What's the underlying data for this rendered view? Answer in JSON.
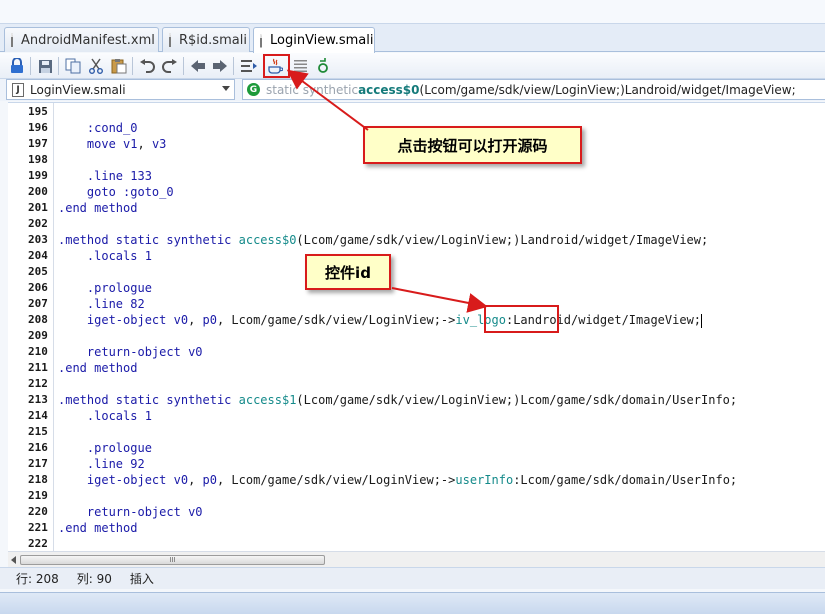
{
  "tabs": [
    {
      "label": "AndroidManifest.xml",
      "active": false
    },
    {
      "label": "R$id.smali",
      "active": false
    },
    {
      "label": "LoginView.smali",
      "active": true
    }
  ],
  "toolbar": {
    "icons": [
      "lock-icon",
      "save-icon",
      "copy-icon",
      "cut-icon",
      "paste-icon",
      "undo-icon",
      "redo-icon",
      "back-icon",
      "forward-icon",
      "outline-icon",
      "java-source-icon",
      "list-icon",
      "refresh-icon"
    ]
  },
  "file_select": {
    "value": "LoginView.smali"
  },
  "method_select": {
    "prefix": "static synthetic ",
    "name": "access$0",
    "signature": "(Lcom/game/sdk/view/LoginView;)Landroid/widget/ImageView;"
  },
  "code": [
    {
      "n": "195",
      "segs": []
    },
    {
      "n": "196",
      "segs": [
        {
          "t": "    ",
          "c": "txt"
        },
        {
          "t": ":cond_0",
          "c": "lbl"
        }
      ]
    },
    {
      "n": "197",
      "segs": [
        {
          "t": "    ",
          "c": "txt"
        },
        {
          "t": "move ",
          "c": "kw"
        },
        {
          "t": "v1",
          "c": "reg"
        },
        {
          "t": ", ",
          "c": "txt"
        },
        {
          "t": "v3",
          "c": "reg"
        }
      ]
    },
    {
      "n": "198",
      "segs": []
    },
    {
      "n": "199",
      "segs": [
        {
          "t": "    ",
          "c": "txt"
        },
        {
          "t": ".line ",
          "c": "kw"
        },
        {
          "t": "133",
          "c": "num"
        }
      ]
    },
    {
      "n": "200",
      "segs": [
        {
          "t": "    ",
          "c": "txt"
        },
        {
          "t": "goto ",
          "c": "kw"
        },
        {
          "t": ":goto_0",
          "c": "lbl"
        }
      ]
    },
    {
      "n": "201",
      "segs": [
        {
          "t": ".end method",
          "c": "kw"
        }
      ]
    },
    {
      "n": "202",
      "segs": []
    },
    {
      "n": "203",
      "segs": [
        {
          "t": ".method static synthetic ",
          "c": "kw"
        },
        {
          "t": "access$0",
          "c": "name"
        },
        {
          "t": "(Lcom/game/sdk/view/LoginView;)Landroid/widget/ImageView;",
          "c": "txt"
        }
      ]
    },
    {
      "n": "204",
      "segs": [
        {
          "t": "    ",
          "c": "txt"
        },
        {
          "t": ".locals ",
          "c": "kw"
        },
        {
          "t": "1",
          "c": "num"
        }
      ]
    },
    {
      "n": "205",
      "segs": []
    },
    {
      "n": "206",
      "segs": [
        {
          "t": "    ",
          "c": "txt"
        },
        {
          "t": ".prologue",
          "c": "kw"
        }
      ]
    },
    {
      "n": "207",
      "segs": [
        {
          "t": "    ",
          "c": "txt"
        },
        {
          "t": ".line ",
          "c": "kw"
        },
        {
          "t": "82",
          "c": "num"
        }
      ]
    },
    {
      "n": "208",
      "segs": [
        {
          "t": "    ",
          "c": "txt"
        },
        {
          "t": "iget-object ",
          "c": "kw"
        },
        {
          "t": "v0",
          "c": "reg"
        },
        {
          "t": ", ",
          "c": "txt"
        },
        {
          "t": "p0",
          "c": "reg"
        },
        {
          "t": ", Lcom/game/sdk/view/LoginView;->",
          "c": "txt"
        },
        {
          "t": "iv_logo",
          "c": "name"
        },
        {
          "t": ":Landroid/widget/ImageView;",
          "c": "txt"
        }
      ]
    },
    {
      "n": "209",
      "segs": []
    },
    {
      "n": "210",
      "segs": [
        {
          "t": "    ",
          "c": "txt"
        },
        {
          "t": "return-object ",
          "c": "kw"
        },
        {
          "t": "v0",
          "c": "reg"
        }
      ]
    },
    {
      "n": "211",
      "segs": [
        {
          "t": ".end method",
          "c": "kw"
        }
      ]
    },
    {
      "n": "212",
      "segs": []
    },
    {
      "n": "213",
      "segs": [
        {
          "t": ".method static synthetic ",
          "c": "kw"
        },
        {
          "t": "access$1",
          "c": "name"
        },
        {
          "t": "(Lcom/game/sdk/view/LoginView;)Lcom/game/sdk/domain/UserInfo;",
          "c": "txt"
        }
      ]
    },
    {
      "n": "214",
      "segs": [
        {
          "t": "    ",
          "c": "txt"
        },
        {
          "t": ".locals ",
          "c": "kw"
        },
        {
          "t": "1",
          "c": "num"
        }
      ]
    },
    {
      "n": "215",
      "segs": []
    },
    {
      "n": "216",
      "segs": [
        {
          "t": "    ",
          "c": "txt"
        },
        {
          "t": ".prologue",
          "c": "kw"
        }
      ]
    },
    {
      "n": "217",
      "segs": [
        {
          "t": "    ",
          "c": "txt"
        },
        {
          "t": ".line ",
          "c": "kw"
        },
        {
          "t": "92",
          "c": "num"
        }
      ]
    },
    {
      "n": "218",
      "segs": [
        {
          "t": "    ",
          "c": "txt"
        },
        {
          "t": "iget-object ",
          "c": "kw"
        },
        {
          "t": "v0",
          "c": "reg"
        },
        {
          "t": ", ",
          "c": "txt"
        },
        {
          "t": "p0",
          "c": "reg"
        },
        {
          "t": ", Lcom/game/sdk/view/LoginView;->",
          "c": "txt"
        },
        {
          "t": "userInfo",
          "c": "name"
        },
        {
          "t": ":Lcom/game/sdk/domain/UserInfo;",
          "c": "txt"
        }
      ]
    },
    {
      "n": "219",
      "segs": []
    },
    {
      "n": "220",
      "segs": [
        {
          "t": "    ",
          "c": "txt"
        },
        {
          "t": "return-object ",
          "c": "kw"
        },
        {
          "t": "v0",
          "c": "reg"
        }
      ]
    },
    {
      "n": "221",
      "segs": [
        {
          "t": ".end method",
          "c": "kw"
        }
      ]
    },
    {
      "n": "222",
      "segs": []
    }
  ],
  "scroll": {
    "thumb_grip": "III"
  },
  "status": {
    "row": "行: 208",
    "col": "列: 90",
    "mode": "插入"
  },
  "annotations": {
    "open_source_callout": "点击按钮可以打开源码",
    "control_id_callout": "控件id",
    "accent_color": "#d81b1b"
  }
}
